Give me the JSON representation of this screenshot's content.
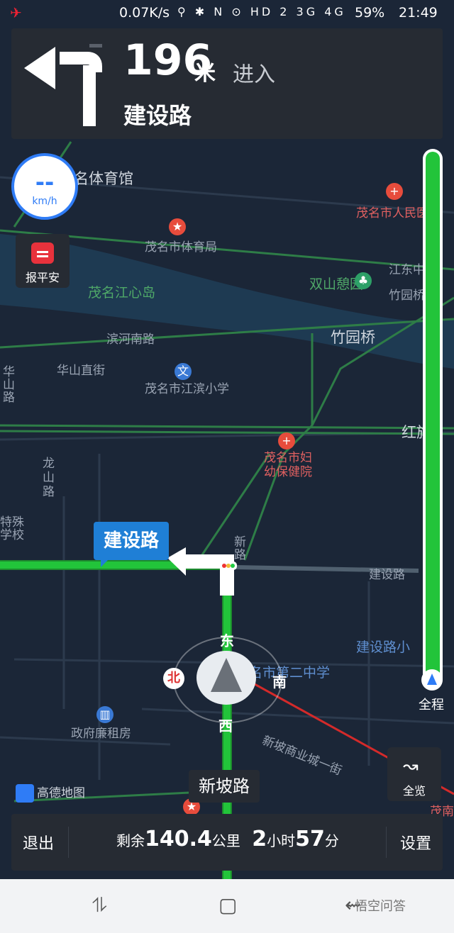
{
  "status_bar": {
    "net_speed": "0.07K/s",
    "indicators": "⚲ ✱ N ⊙ HD 2 3G 4G",
    "battery": "59%",
    "time": "21:49"
  },
  "instruction": {
    "distance": "196",
    "unit": "米",
    "action": "进入",
    "road": "建设路"
  },
  "speed": {
    "value": "--",
    "unit": "km/h"
  },
  "safety_button": {
    "label": "报平安"
  },
  "progress": {
    "label": "全程",
    "fraction": 1.0
  },
  "overview_button": {
    "label": "全览"
  },
  "current_road_tag": "建设路",
  "next_road_tag": "新坡路",
  "compass": {
    "north": "北",
    "east": "东",
    "south": "南",
    "west": "西"
  },
  "map_labels": {
    "sports_museum": "名体育馆",
    "sports_bureau": "茂名市体育局",
    "hospital": "茂名市人民医",
    "river_island": "茂名江心岛",
    "shuangshan": "双山憩园",
    "jiangdong": "江东中",
    "zhuyuan_bridge": "竹园桥",
    "zhuyuan_bridge2": "竹园桥",
    "binhe_road": "滨河南路",
    "huashan_street": "华山直街",
    "jiangbin_school": "茂名市江滨小学",
    "huashan_road": "华山路",
    "hongqi": "红旗",
    "maternity": "茂名市妇幼保健院",
    "longshan_road": "龙山路",
    "special_school": "特殊学校",
    "jianshe_road_right": "建设路",
    "xin_road": "新路",
    "jianshe_school": "建设路小",
    "second_middle": "茂名市第二中学",
    "gov_housing": "政府廉租房",
    "xinpo_street": "新坡商业城一街",
    "maonan": "茂南",
    "slope_left": "路"
  },
  "logo": "高德地图",
  "bottom_bar": {
    "exit": "退出",
    "remaining_prefix": "剩余",
    "remaining_distance": "140.4",
    "distance_unit": "公里",
    "hours": "2",
    "hours_unit": "小时",
    "minutes": "57",
    "minutes_unit": "分",
    "settings": "设置"
  },
  "nav_bar": {
    "recent": "⥮",
    "home": "▢",
    "back": "⇜",
    "watermark": "悟空问答"
  },
  "colors": {
    "route": "#22c43a",
    "panel": "#262b33",
    "accent": "#2f7cf6",
    "map_bg": "#1b2637"
  }
}
